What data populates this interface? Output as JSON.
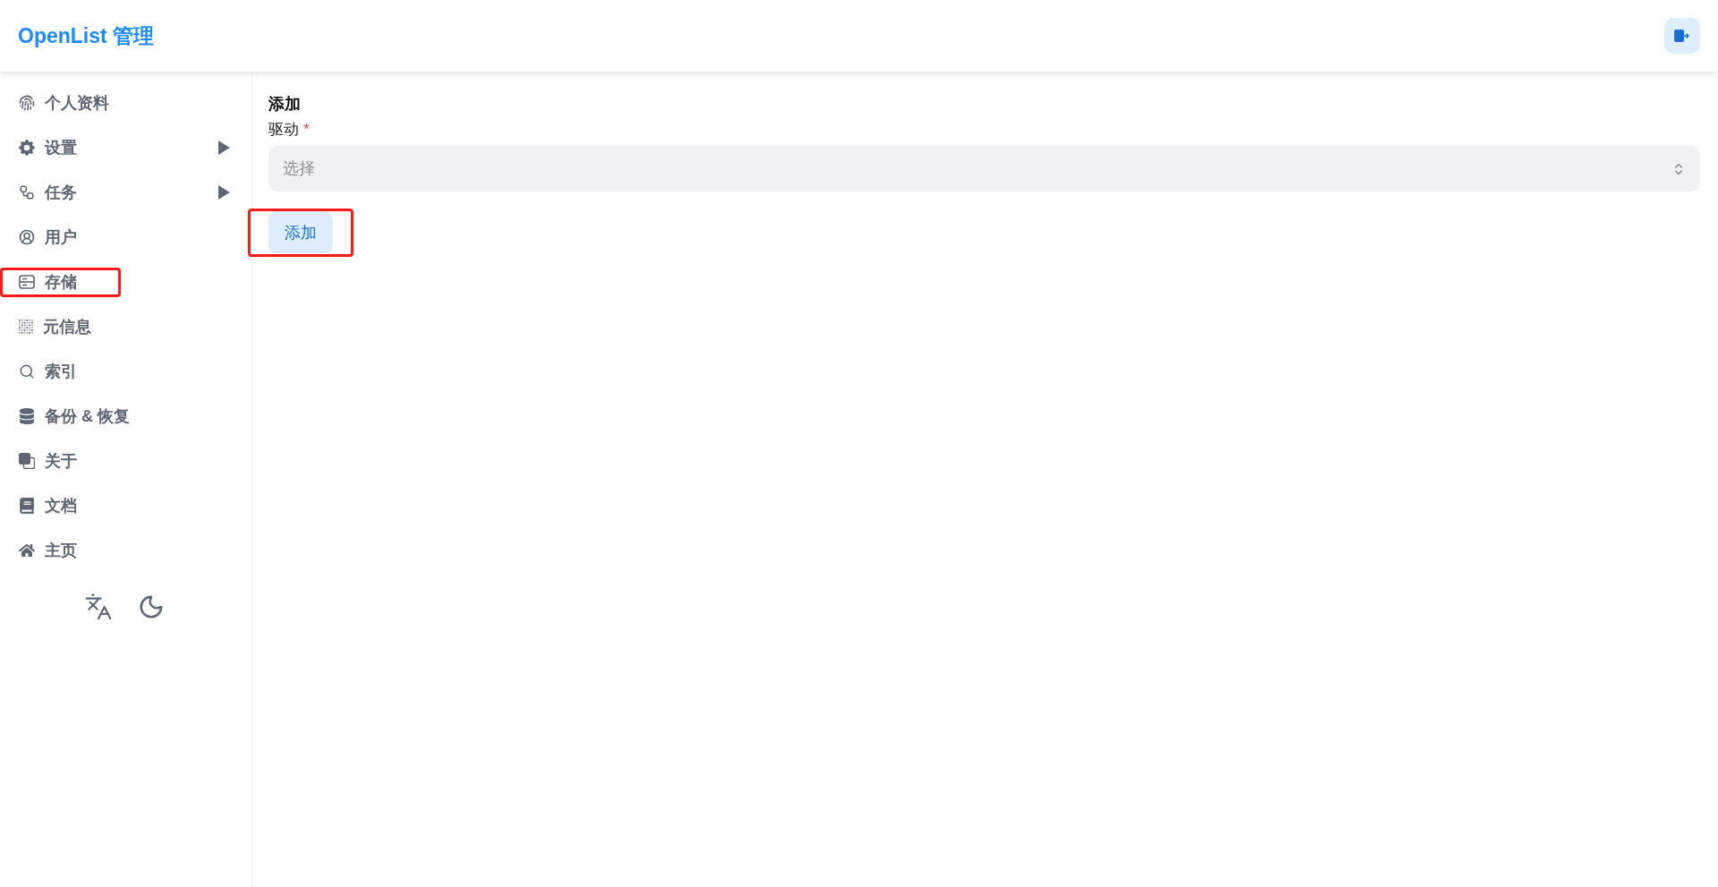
{
  "header": {
    "title": "OpenList 管理"
  },
  "sidebar": {
    "items": [
      {
        "label": "个人资料",
        "kind": "link",
        "highlighted": false
      },
      {
        "label": "设置",
        "kind": "group",
        "expanded": false,
        "highlighted": false
      },
      {
        "label": "任务",
        "kind": "group",
        "expanded": false,
        "highlighted": false
      },
      {
        "label": "用户",
        "kind": "link",
        "highlighted": false
      },
      {
        "label": "存储",
        "kind": "link",
        "highlighted": true
      },
      {
        "label": "元信息",
        "kind": "link",
        "highlighted": false
      },
      {
        "label": "索引",
        "kind": "link",
        "highlighted": false
      },
      {
        "label": "备份 & 恢复",
        "kind": "link",
        "highlighted": false
      },
      {
        "label": "关于",
        "kind": "link",
        "highlighted": false
      },
      {
        "label": "文档",
        "kind": "link",
        "highlighted": false
      },
      {
        "label": "主页",
        "kind": "link",
        "highlighted": false
      }
    ]
  },
  "main": {
    "heading": "添加",
    "field": {
      "label": "驱动",
      "required_mark": "*",
      "placeholder": "选择"
    },
    "submit_button": {
      "label": "添加",
      "highlighted": true
    }
  }
}
